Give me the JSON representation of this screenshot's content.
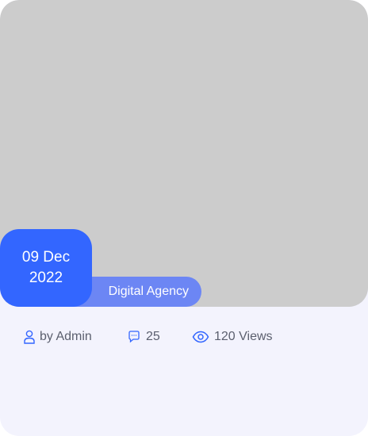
{
  "post": {
    "date_line1": "09 Dec",
    "date_line2": "2022",
    "category": "Digital Agency",
    "author": "by Admin",
    "comments": "25",
    "views": "120 Views"
  },
  "icons": {
    "author": "user-icon",
    "comments": "comment-icon",
    "views": "eye-icon"
  },
  "colors": {
    "accent": "#3366ff",
    "category_bg": "#6c86f4",
    "card_bg": "#f3f3fd",
    "thumbnail": "#cccccc"
  }
}
